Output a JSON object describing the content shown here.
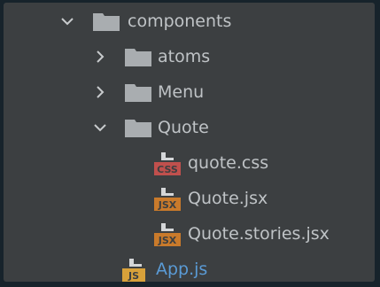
{
  "tree": {
    "root": {
      "label": "components",
      "expanded": true,
      "icon": "folder-icon"
    },
    "children": [
      {
        "label": "atoms",
        "expanded": false,
        "icon": "folder-icon"
      },
      {
        "label": "Menu",
        "expanded": false,
        "icon": "folder-icon"
      },
      {
        "label": "Quote",
        "expanded": true,
        "icon": "folder-icon",
        "files": [
          {
            "label": "quote.css",
            "badge": "CSS",
            "icon": "css-file-icon"
          },
          {
            "label": "Quote.jsx",
            "badge": "JSX",
            "icon": "jsx-file-icon"
          },
          {
            "label": "Quote.stories.jsx",
            "badge": "JSX",
            "icon": "jsx-file-icon"
          }
        ]
      }
    ],
    "sibling": {
      "label": "App.js",
      "badge": "JS",
      "icon": "js-file-icon"
    }
  },
  "colors": {
    "background": "#3c3f41",
    "text": "#bfc3c6",
    "folder": "#a9adb0",
    "css_badge": "#c0504d",
    "jsx_badge": "#c97a2b",
    "js_badge": "#d8a13a",
    "js_label": "#5a9bd6"
  }
}
